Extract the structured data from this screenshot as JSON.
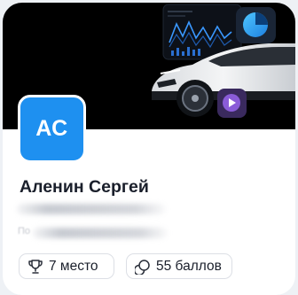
{
  "profile": {
    "initials": "АС",
    "name": "Аленин Сергей",
    "subtitle_visible_fragment": "По"
  },
  "stats": [
    {
      "icon": "trophy-icon",
      "label": "7 место"
    },
    {
      "icon": "points-icon",
      "label": "55 баллов"
    }
  ],
  "colors": {
    "avatar": "#1e90f0",
    "cover_background": "#000000",
    "chip_border": "#dcdfe5"
  }
}
